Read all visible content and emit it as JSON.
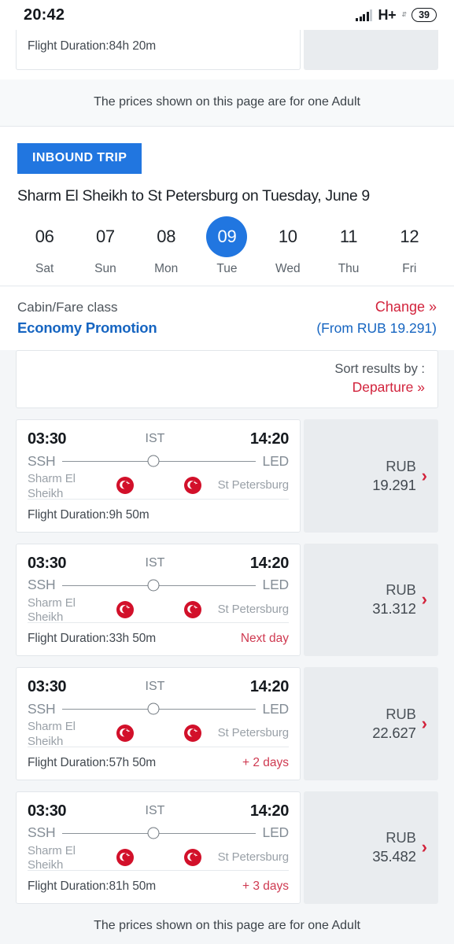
{
  "status_bar": {
    "time": "20:42",
    "network_label": "H+",
    "network_arrows": "⇵",
    "battery_level": "39",
    "signal_icon": "signal-bars-icon"
  },
  "partial_card": {
    "duration_label": "Flight Duration:",
    "duration_value": "84h 20m",
    "duration_full": "Flight Duration:84h 20m"
  },
  "top_notice": "The prices shown on this page are for one Adult",
  "trip": {
    "badge": "INBOUND TRIP",
    "title": "Sharm El Sheikh to St Petersburg on Tuesday, June 9",
    "badge_color": "#2176e0"
  },
  "dates": [
    {
      "num": "06",
      "day": "Sat",
      "selected": false
    },
    {
      "num": "07",
      "day": "Sun",
      "selected": false
    },
    {
      "num": "08",
      "day": "Mon",
      "selected": false
    },
    {
      "num": "09",
      "day": "Tue",
      "selected": true
    },
    {
      "num": "10",
      "day": "Wed",
      "selected": false
    },
    {
      "num": "11",
      "day": "Thu",
      "selected": false
    },
    {
      "num": "12",
      "day": "Fri",
      "selected": false
    }
  ],
  "cabin": {
    "label": "Cabin/Fare class",
    "value": "Economy Promotion",
    "change_link": "Change »",
    "from_price": "(From RUB 19.291)",
    "link_color": "#d2233c",
    "value_color": "#1665c1"
  },
  "sort": {
    "label": "Sort results by :",
    "value": "Departure  »"
  },
  "flights": [
    {
      "depart_time": "03:30",
      "arrive_time": "14:20",
      "stop_code": "IST",
      "origin_code": "SSH",
      "destination_code": "LED",
      "origin_city": "Sharm El Sheikh",
      "destination_city": "St Petersburg",
      "duration": "Flight Duration:9h 50m",
      "day_note": "",
      "currency": "RUB",
      "price": "19.291"
    },
    {
      "depart_time": "03:30",
      "arrive_time": "14:20",
      "stop_code": "IST",
      "origin_code": "SSH",
      "destination_code": "LED",
      "origin_city": "Sharm El Sheikh",
      "destination_city": "St Petersburg",
      "duration": "Flight Duration:33h 50m",
      "day_note": "Next day",
      "currency": "RUB",
      "price": "31.312"
    },
    {
      "depart_time": "03:30",
      "arrive_time": "14:20",
      "stop_code": "IST",
      "origin_code": "SSH",
      "destination_code": "LED",
      "origin_city": "Sharm El Sheikh",
      "destination_city": "St Petersburg",
      "duration": "Flight Duration:57h 50m",
      "day_note": "+ 2 days",
      "currency": "RUB",
      "price": "22.627"
    },
    {
      "depart_time": "03:30",
      "arrive_time": "14:20",
      "stop_code": "IST",
      "origin_code": "SSH",
      "destination_code": "LED",
      "origin_city": "Sharm El Sheikh",
      "destination_city": "St Petersburg",
      "duration": "Flight Duration:81h 50m",
      "day_note": "+ 3 days",
      "currency": "RUB",
      "price": "35.482"
    }
  ],
  "bottom_notice": "The prices shown on this page are for one Adult",
  "airline_logo": "turkish-airlines-logo-icon",
  "logo_color": "#d2102a"
}
